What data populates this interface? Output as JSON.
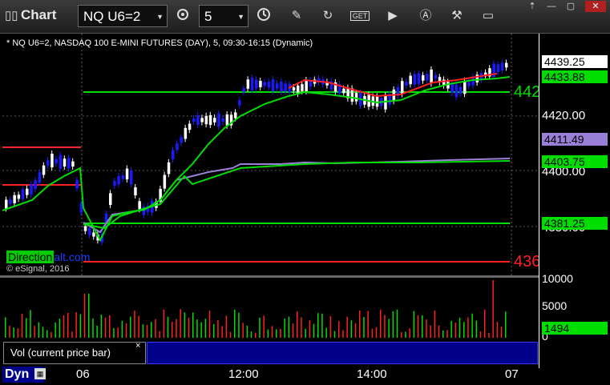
{
  "window": {
    "icon": "chart-bars-icon",
    "title": "Chart"
  },
  "toolbar": {
    "symbol_value": "NQ U6=2",
    "interval_value": "5",
    "buttons": [
      "pencil-icon",
      "refresh-icon",
      "get-icon",
      "play-icon",
      "alert-icon",
      "tools-icon",
      "chat-icon"
    ],
    "get_label": "GET"
  },
  "chart": {
    "symbol_line": "* NQ U6=2, NASDAQ 100 E-MINI FUTURES (DAY), 5, 09:30-16:15 (Dynamic)",
    "watermark_box": "Direction",
    "watermark_rest": "alt.com",
    "copyright": "© eSignal, 2016",
    "price_ticks": [
      "4420.00",
      "4400.00",
      "4380.00"
    ],
    "price_labels": [
      {
        "text": "4439.25",
        "bg": "#ffffff",
        "fg": "#000000"
      },
      {
        "text": "4433.88",
        "bg": "#00dd00",
        "fg": "#000000"
      },
      {
        "text": "4411.49",
        "bg": "#9a7fd6",
        "fg": "#000000"
      },
      {
        "text": "4403.75",
        "bg": "#00dd00",
        "fg": "#000000"
      },
      {
        "text": "4381.25",
        "bg": "#00dd00",
        "fg": "#000000"
      }
    ],
    "level_labels": {
      "green": "442",
      "red": "436"
    },
    "colors": {
      "up": "#ffffff",
      "down": "#1a1aff",
      "red_ma": "#ff2020",
      "green_ma": "#00dd00",
      "purple_ma": "#9a7fd6"
    }
  },
  "volume": {
    "ticks": [
      "10000",
      "5000",
      "0"
    ],
    "current_label": "1494",
    "tab_label": "Vol (current price bar)",
    "close": "×"
  },
  "time_axis": {
    "labels": [
      "06",
      "12:00",
      "14:00",
      "07"
    ],
    "dyn_label": "Dyn"
  }
}
